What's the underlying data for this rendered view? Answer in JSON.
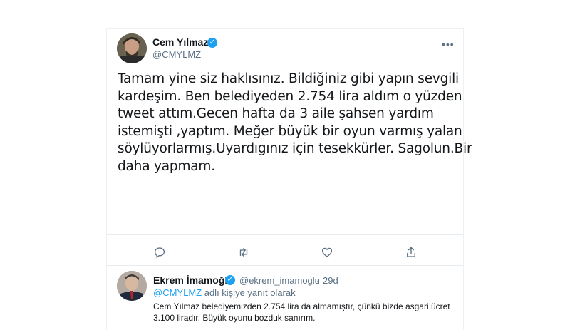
{
  "tweet": {
    "author_name": "Cem Yılmaz",
    "handle": "@CMYLMZ",
    "lines": [
      "Tamam yine siz haklısınız. Bildiğiniz gibi yapın sevgili",
      "kardeşim. Ben belediyeden 2.754 lira aldım o yüzden",
      "tweet attım.Gecen hafta da 3  aile şahsen yardım",
      "istemişti ,yaptım. Meğer büyük bir oyun varmış yalan",
      "söylüyorlarmış.Uyardıgınız için tesekkürler. Sagolun.Bir",
      "daha yapmam."
    ],
    "more_label": "•••"
  },
  "actions": {
    "reply_icon": "reply-icon",
    "retweet_icon": "retweet-icon",
    "like_icon": "heart-icon",
    "share_icon": "share-icon"
  },
  "reply": {
    "author_name": "Ekrem İmamoğlu",
    "handle": "@ekrem_imamoglu",
    "separator": "·",
    "time": "29d",
    "mention": "@CMYLMZ",
    "replying_suffix": "adlı kişiye yanıt olarak",
    "text": "Cem Yılmaz belediyemizden 2.754 lira da almamıştır, çünkü bizde asgari ücret 3.100 liradır. Büyük oyunu bozduk sanırım."
  },
  "colors": {
    "accent": "#1da1f2",
    "secondary_text": "#5b7083",
    "divider": "#e6ecf0"
  }
}
